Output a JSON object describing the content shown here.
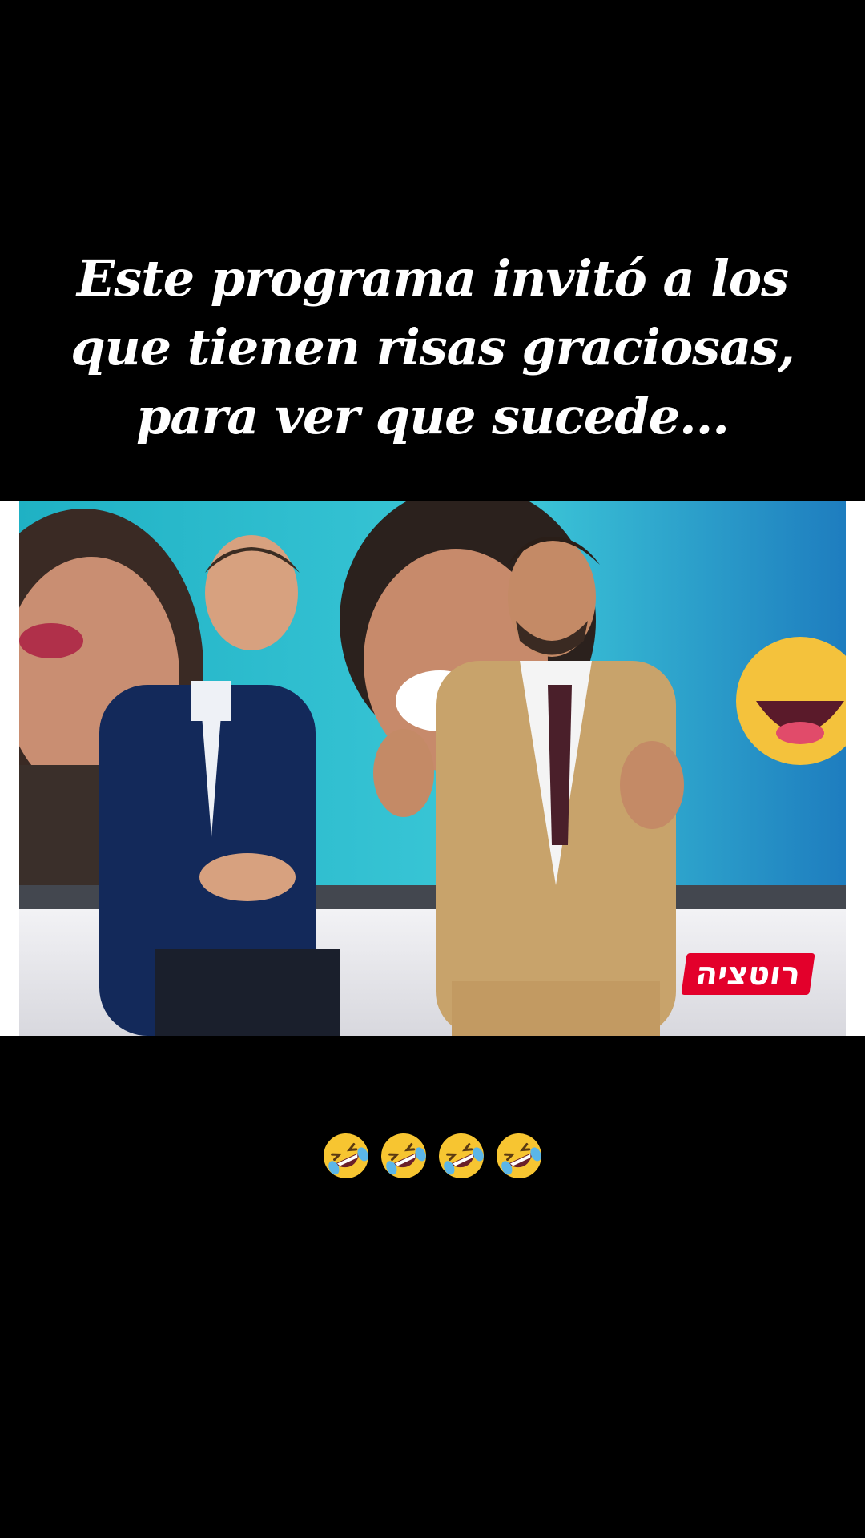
{
  "caption": {
    "lines": [
      "Este programa invitó a los",
      "que tienen risas graciosas,",
      "para ver que sucede..."
    ]
  },
  "video": {
    "channel_logo": "רוטציה",
    "background_color": "#20b8c8"
  },
  "reaction": {
    "emoji_name": "rolling-on-the-floor-laughing-emoji",
    "count": 4
  }
}
